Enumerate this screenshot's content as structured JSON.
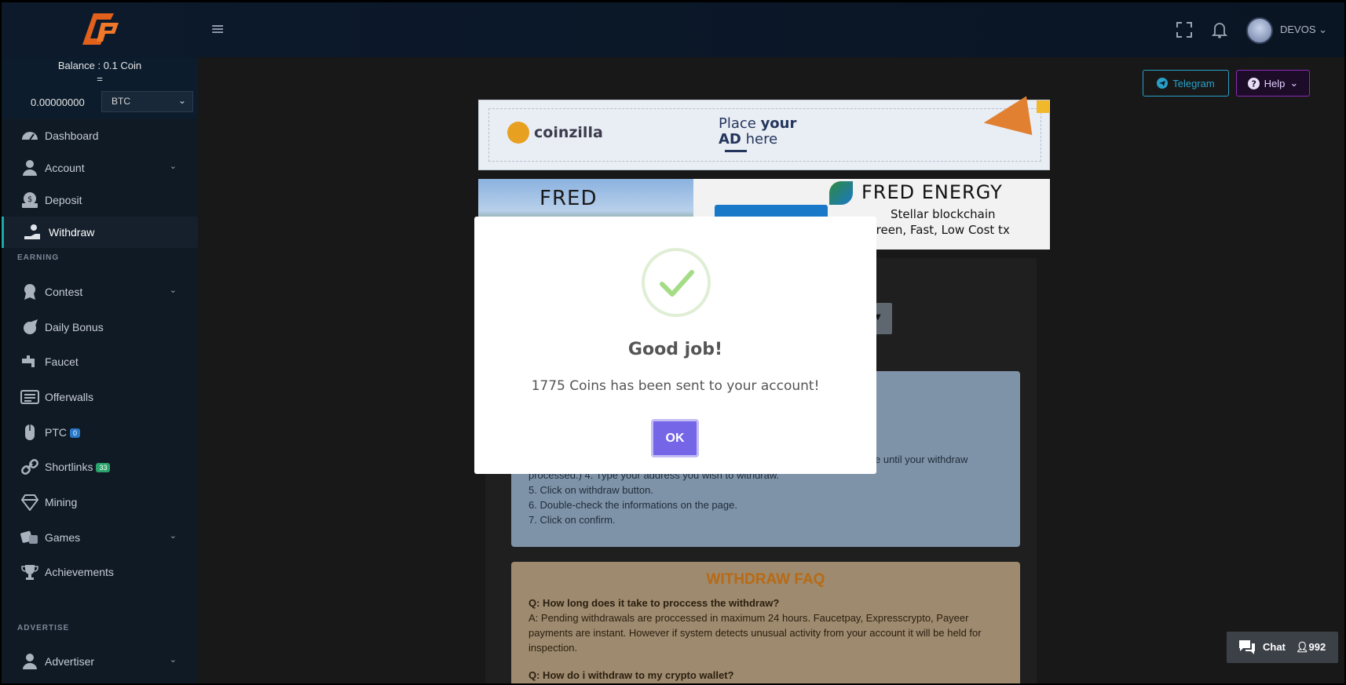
{
  "topbar": {
    "username": "DEVOS",
    "menu_glyph": "≡"
  },
  "balance": {
    "line1": "Balance : 0.1 Coin",
    "equals": "=",
    "amount": "0.00000000",
    "currency": "BTC"
  },
  "sidebar": {
    "items": [
      {
        "label": "Dashboard",
        "icon": "dashboard-icon"
      },
      {
        "label": "Account",
        "icon": "user-icon"
      },
      {
        "label": "Deposit",
        "icon": "money-icon"
      },
      {
        "label": "Withdraw",
        "icon": "hand-coin-icon"
      },
      {
        "label": "Contest",
        "icon": "medal-icon"
      },
      {
        "label": "Daily Bonus",
        "icon": "rocket-icon"
      },
      {
        "label": "Faucet",
        "icon": "faucet-icon"
      },
      {
        "label": "Offerwalls",
        "icon": "list-icon"
      },
      {
        "label": "PTC",
        "icon": "mouse-icon",
        "badge": "0"
      },
      {
        "label": "Shortlinks",
        "icon": "link-icon",
        "badge": "33"
      },
      {
        "label": "Mining",
        "icon": "diamond-icon"
      },
      {
        "label": "Games",
        "icon": "dice-icon"
      },
      {
        "label": "Achievements",
        "icon": "trophy-icon"
      },
      {
        "label": "Advertiser",
        "icon": "advertiser-icon"
      }
    ],
    "sections": {
      "earning": "EARNING",
      "advertise": "ADVERTISE"
    }
  },
  "buttons": {
    "telegram": "Telegram",
    "help": "Help"
  },
  "ads": {
    "brand": "coinzilla",
    "place_line1_a": "Place ",
    "place_line1_b": "your",
    "place_line2_a": "AD",
    "place_line2_b": " here",
    "fred_photo_text": "FRED",
    "fred_title": "FRED ENERGY",
    "fred_sub1": "Stellar blockchain",
    "fred_sub2": "Green, Fast, Low Cost tx"
  },
  "steps": {
    "partial_right": "e until your withdraw",
    "step4": "processed.) 4. Type your address you wish to withdraw.",
    "step5": "5. Click on withdraw button.",
    "step6": "6. Double-check the informations on the page.",
    "step7": "7. Click on confirm."
  },
  "faq": {
    "title": "WITHDRAW FAQ",
    "q1": "Q: How long does it take to proccess the withdraw?",
    "a1": "A: Pending withdrawals are proccessed in maximum 24 hours. Faucetpay, Expresscrypto, Payeer payments are instant. However if system detects unusual activity from your account it will be held for inspection.",
    "q2": "Q: How do i withdraw to my crypto wallet?"
  },
  "modal": {
    "title": "Good job!",
    "message": "1775 Coins has been sent to your account!",
    "ok": "OK"
  },
  "chat": {
    "label": "Chat",
    "count": "992"
  },
  "colors": {
    "accent_teal": "#1ba8a8",
    "modal_ok": "#7566e8",
    "success_green": "#a5dc86",
    "faq_title": "#b86a14"
  }
}
